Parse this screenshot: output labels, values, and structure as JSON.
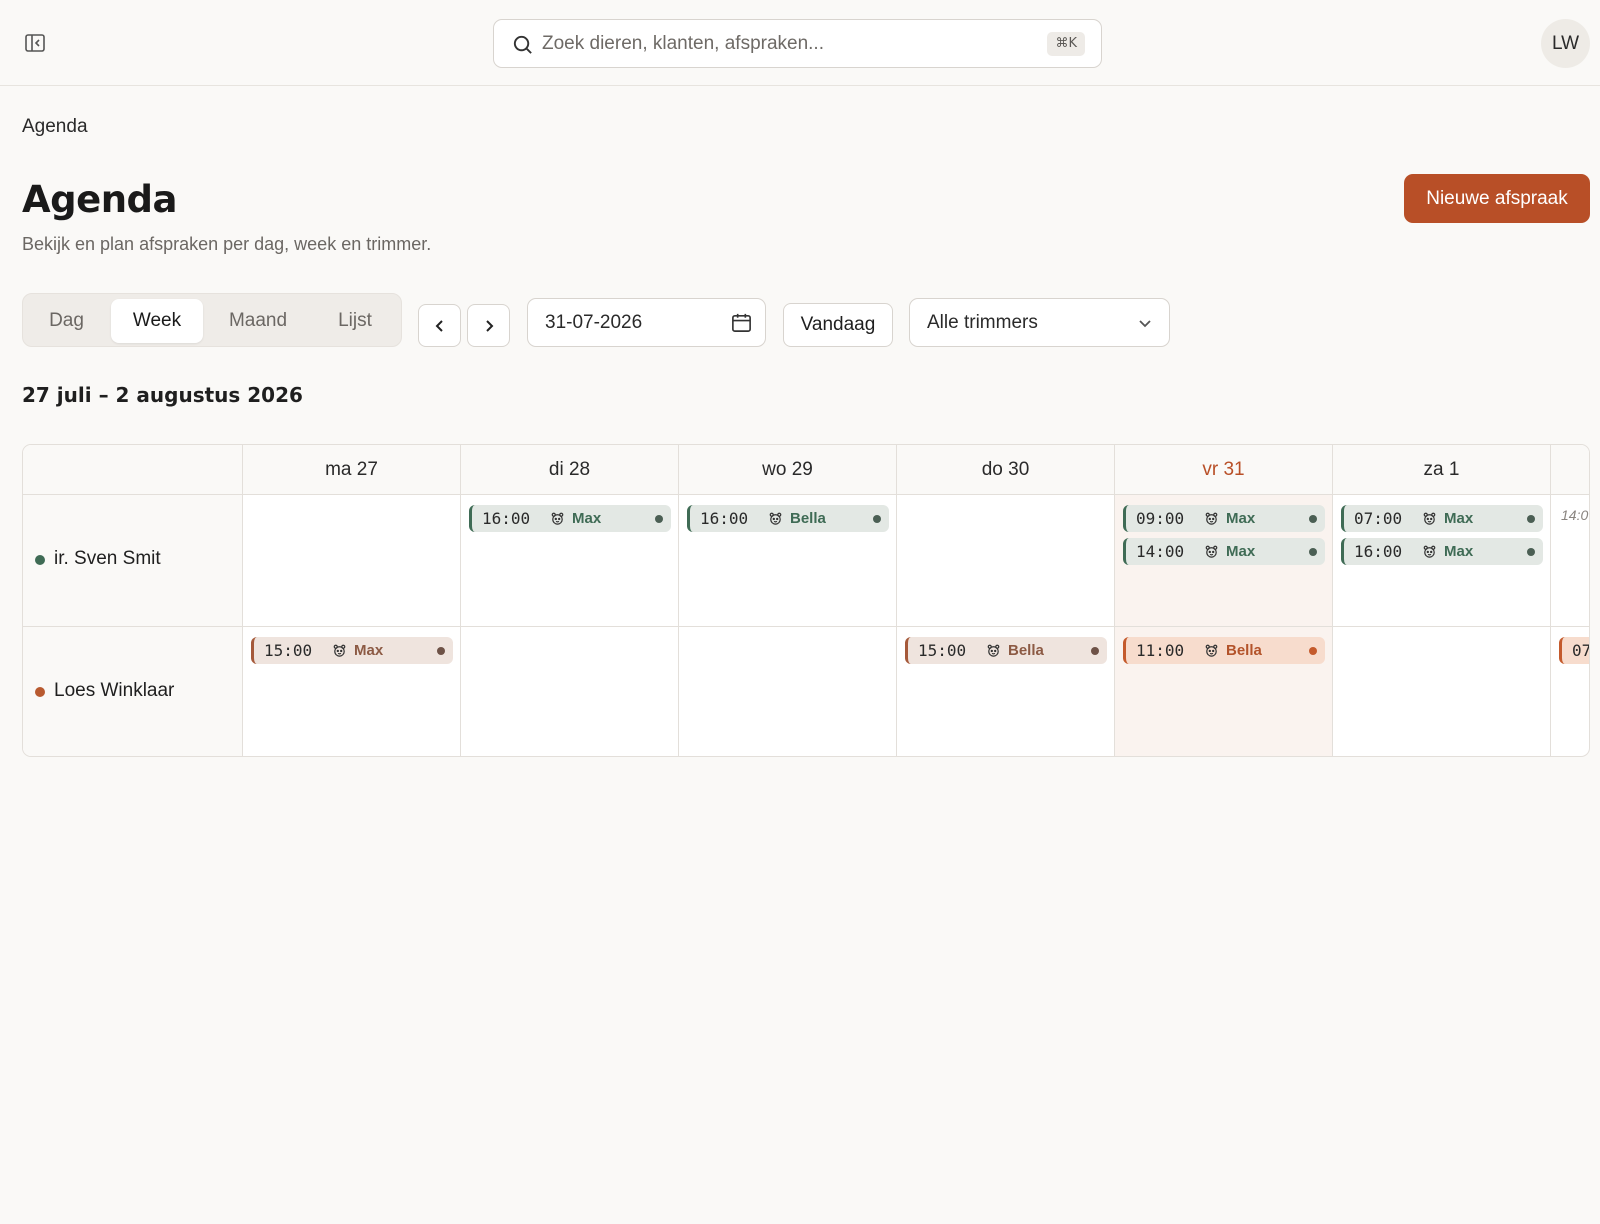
{
  "topbar": {
    "search_placeholder": "Zoek dieren, klanten, afspraken...",
    "search_shortcut": "⌘K",
    "avatar_initials": "LW"
  },
  "breadcrumb": "Agenda",
  "header": {
    "title": "Agenda",
    "subtitle": "Bekijk en plan afspraken per dag, week en trimmer.",
    "new_button": "Nieuwe afspraak"
  },
  "toolbar": {
    "views": [
      {
        "label": "Dag",
        "active": false
      },
      {
        "label": "Week",
        "active": true
      },
      {
        "label": "Maand",
        "active": false
      },
      {
        "label": "Lijst",
        "active": false
      }
    ],
    "date_value": "31-07-2026",
    "today_label": "Vandaag",
    "trimmer_filter": "Alle trimmers"
  },
  "range_title": "27 juli – 2 augustus 2026",
  "colors": {
    "accent": "#b84f27",
    "sven": "#3f6b55",
    "loes": "#b85a30"
  },
  "calendar": {
    "days": [
      {
        "label": "ma 27",
        "today": false
      },
      {
        "label": "di 28",
        "today": false
      },
      {
        "label": "wo 29",
        "today": false
      },
      {
        "label": "do 30",
        "today": false
      },
      {
        "label": "vr 31",
        "today": true
      },
      {
        "label": "za 1",
        "today": false
      },
      {
        "label": "",
        "today": false
      }
    ],
    "rows": [
      {
        "name": "ir. Sven Smit",
        "color": "#3f6b55",
        "cells": [
          [],
          [
            {
              "time": "16:00",
              "pet": "Max",
              "style": "green"
            }
          ],
          [
            {
              "time": "16:00",
              "pet": "Bella",
              "style": "green"
            }
          ],
          [],
          [
            {
              "time": "09:00",
              "pet": "Max",
              "style": "green"
            },
            {
              "time": "14:00",
              "pet": "Max",
              "style": "green"
            }
          ],
          [
            {
              "time": "07:00",
              "pet": "Max",
              "style": "green"
            },
            {
              "time": "16:00",
              "pet": "Max",
              "style": "green"
            }
          ],
          [
            {
              "overflow": "14:0"
            }
          ]
        ]
      },
      {
        "name": "Loes Winklaar",
        "color": "#b85a30",
        "cells": [
          [
            {
              "time": "15:00",
              "pet": "Max",
              "style": "brown"
            }
          ],
          [],
          [],
          [
            {
              "time": "15:00",
              "pet": "Bella",
              "style": "brown"
            }
          ],
          [
            {
              "time": "11:00",
              "pet": "Bella",
              "style": "orange"
            }
          ],
          [],
          [
            {
              "time": "07",
              "pet": "",
              "style": "orange"
            }
          ]
        ]
      }
    ]
  }
}
